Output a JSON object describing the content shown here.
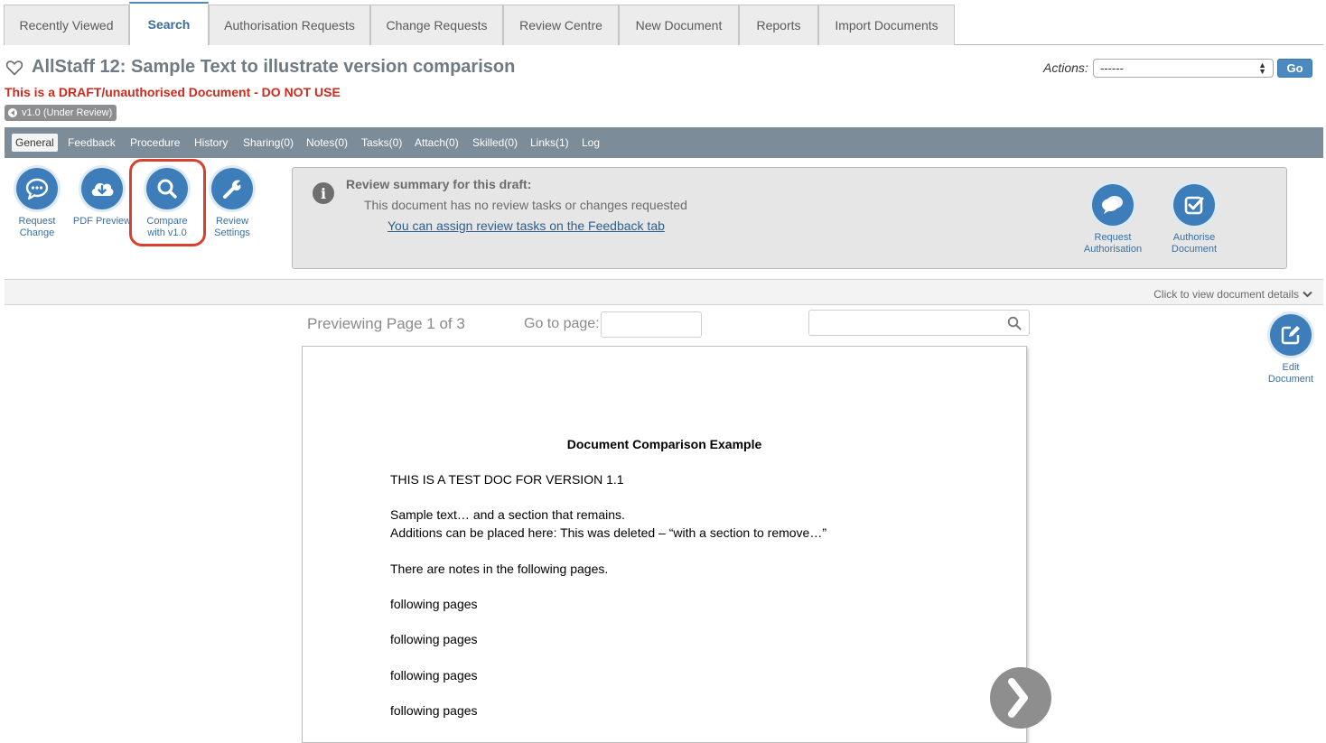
{
  "top_tabs": [
    {
      "label": "Recently Viewed"
    },
    {
      "label": "Search"
    },
    {
      "label": "Authorisation Requests"
    },
    {
      "label": "Change Requests"
    },
    {
      "label": "Review Centre"
    },
    {
      "label": "New Document"
    },
    {
      "label": "Reports"
    },
    {
      "label": "Import Documents"
    }
  ],
  "active_tab": "Search",
  "header": {
    "title": "AllStaff 12: Sample Text to illustrate version comparison",
    "draft_warning": "This is a DRAFT/unauthorised Document - DO NOT USE",
    "version_badge": "v1.0 (Under Review)",
    "actions_label": "Actions:",
    "actions_selected": "------",
    "go_label": "Go"
  },
  "sub_tabs": [
    "General",
    "Feedback",
    "Procedure",
    "History",
    "Sharing(0)",
    "Notes(0)",
    "Tasks(0)",
    "Attach(0)",
    "Skilled(0)",
    "Links(1)",
    "Log"
  ],
  "active_sub_tab": "General",
  "tools": {
    "request_change": {
      "line1": "Request",
      "line2": "Change"
    },
    "pdf_preview": {
      "line1": "PDF Preview",
      "line2": ""
    },
    "compare": {
      "line1": "Compare",
      "line2": "with v1.0"
    },
    "review_settings": {
      "line1": "Review",
      "line2": "Settings"
    }
  },
  "review_summary": {
    "title": "Review summary for this draft:",
    "text": "This document has no review tasks or changes requested",
    "link": "You can assign review tasks on the Feedback tab",
    "request_authorisation": {
      "line1": "Request",
      "line2": "Authorisation"
    },
    "authorise_document": {
      "line1": "Authorise",
      "line2": "Document"
    }
  },
  "details_link": "Click to view document details",
  "preview": {
    "label": "Previewing Page 1 of 3",
    "goto_label": "Go to page:",
    "goto_value": "",
    "search_value": ""
  },
  "edit_document": {
    "line1": "Edit",
    "line2": "Document"
  },
  "document": {
    "heading": "Document Comparison Example",
    "lines": [
      "THIS IS A TEST DOC FOR VERSION 1.1",
      "Sample text… and a section that remains.",
      "Additions can be placed here: This was deleted – “with a section to remove…”",
      "There are notes in the following pages.",
      "following pages",
      "following pages",
      "following pages",
      "following pages"
    ]
  },
  "colors": {
    "accent": "#3d7dba",
    "warning": "#cf2a1d",
    "subnav": "#7d8c99",
    "highlight": "#d9412d"
  }
}
